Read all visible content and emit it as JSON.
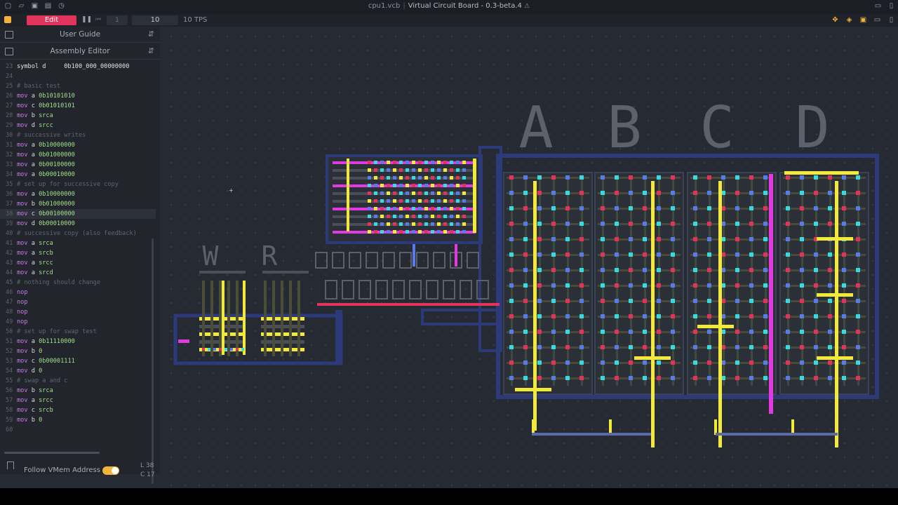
{
  "window": {
    "file_name": "cpu1.vcb",
    "app_name": "Virtual Circuit Board - 0.3-beta.4",
    "left_icons": [
      "new-file-icon",
      "open-folder-icon",
      "save-icon",
      "save-as-icon",
      "settings-clock-icon"
    ],
    "right_icons": [
      "book-icon",
      "panel-toggle-icon"
    ]
  },
  "toolbar": {
    "edit_label": "Edit",
    "pause_symbol": "❚❚",
    "step_symbol": "⏮",
    "step_value": "1",
    "speed_value": "10",
    "tps_label": "10 TPS",
    "right_icons": [
      "pin-icon",
      "layers-icon",
      "square-icon",
      "chat-icon",
      "sidebar-icon"
    ]
  },
  "sidebar": {
    "user_guide_title": "User Guide",
    "assembly_editor_title": "Assembly Editor",
    "code_lines": [
      {
        "n": "23",
        "parts": [
          [
            "ident",
            "symbol d     0b100_000_00000000"
          ]
        ]
      },
      {
        "n": "24",
        "parts": []
      },
      {
        "n": "25",
        "parts": [
          [
            "cmt",
            "# basic test"
          ]
        ]
      },
      {
        "n": "26",
        "parts": [
          [
            "kw",
            "mov "
          ],
          [
            "arg",
            "a "
          ],
          [
            "num",
            "0b10101010"
          ]
        ]
      },
      {
        "n": "27",
        "parts": [
          [
            "kw",
            "mov "
          ],
          [
            "arg",
            "c "
          ],
          [
            "num",
            "0b01010101"
          ]
        ]
      },
      {
        "n": "28",
        "parts": [
          [
            "kw",
            "mov "
          ],
          [
            "arg",
            "b "
          ],
          [
            "num",
            "srca"
          ]
        ]
      },
      {
        "n": "29",
        "parts": [
          [
            "kw",
            "mov "
          ],
          [
            "arg",
            "d "
          ],
          [
            "num",
            "srcc"
          ]
        ]
      },
      {
        "n": "30",
        "parts": [
          [
            "cmt",
            "# successive writes"
          ]
        ]
      },
      {
        "n": "31",
        "parts": [
          [
            "kw",
            "mov "
          ],
          [
            "arg",
            "a "
          ],
          [
            "num",
            "0b10000000"
          ]
        ]
      },
      {
        "n": "32",
        "parts": [
          [
            "kw",
            "mov "
          ],
          [
            "arg",
            "a "
          ],
          [
            "num",
            "0b01000000"
          ]
        ]
      },
      {
        "n": "33",
        "parts": [
          [
            "kw",
            "mov "
          ],
          [
            "arg",
            "a "
          ],
          [
            "num",
            "0b00100000"
          ]
        ]
      },
      {
        "n": "34",
        "parts": [
          [
            "kw",
            "mov "
          ],
          [
            "arg",
            "a "
          ],
          [
            "num",
            "0b00010000"
          ]
        ]
      },
      {
        "n": "35",
        "parts": [
          [
            "cmt",
            "# set up for successive copy"
          ]
        ]
      },
      {
        "n": "36",
        "parts": [
          [
            "kw",
            "mov "
          ],
          [
            "arg",
            "a "
          ],
          [
            "num",
            "0b10000000"
          ]
        ]
      },
      {
        "n": "37",
        "parts": [
          [
            "kw",
            "mov "
          ],
          [
            "arg",
            "b "
          ],
          [
            "num",
            "0b01000000"
          ]
        ]
      },
      {
        "n": "38",
        "parts": [
          [
            "kw",
            "mov "
          ],
          [
            "arg",
            "c "
          ],
          [
            "num",
            "0b00100000"
          ]
        ],
        "hl": true
      },
      {
        "n": "39",
        "parts": [
          [
            "kw",
            "mov "
          ],
          [
            "arg",
            "d "
          ],
          [
            "num",
            "0b00010000"
          ]
        ]
      },
      {
        "n": "40",
        "parts": [
          [
            "cmt",
            "# successive copy (also feedback)"
          ]
        ]
      },
      {
        "n": "41",
        "parts": [
          [
            "kw",
            "mov "
          ],
          [
            "arg",
            "a "
          ],
          [
            "num",
            "srca"
          ]
        ]
      },
      {
        "n": "42",
        "parts": [
          [
            "kw",
            "mov "
          ],
          [
            "arg",
            "a "
          ],
          [
            "num",
            "srcb"
          ]
        ]
      },
      {
        "n": "43",
        "parts": [
          [
            "kw",
            "mov "
          ],
          [
            "arg",
            "a "
          ],
          [
            "num",
            "srcc"
          ]
        ]
      },
      {
        "n": "44",
        "parts": [
          [
            "kw",
            "mov "
          ],
          [
            "arg",
            "a "
          ],
          [
            "num",
            "srcd"
          ]
        ]
      },
      {
        "n": "45",
        "parts": [
          [
            "cmt",
            "# nothing should change"
          ]
        ]
      },
      {
        "n": "46",
        "parts": [
          [
            "kw",
            "nop"
          ]
        ]
      },
      {
        "n": "47",
        "parts": [
          [
            "kw",
            "nop"
          ]
        ]
      },
      {
        "n": "48",
        "parts": [
          [
            "kw",
            "nop"
          ]
        ]
      },
      {
        "n": "49",
        "parts": [
          [
            "kw",
            "nop"
          ]
        ]
      },
      {
        "n": "50",
        "parts": [
          [
            "cmt",
            "# set up for swap test"
          ]
        ]
      },
      {
        "n": "51",
        "parts": [
          [
            "kw",
            "mov "
          ],
          [
            "arg",
            "a "
          ],
          [
            "num",
            "0b11110000"
          ]
        ]
      },
      {
        "n": "52",
        "parts": [
          [
            "kw",
            "mov "
          ],
          [
            "arg",
            "b "
          ],
          [
            "num",
            "0"
          ]
        ]
      },
      {
        "n": "53",
        "parts": [
          [
            "kw",
            "mov "
          ],
          [
            "arg",
            "c "
          ],
          [
            "num",
            "0b00001111"
          ]
        ]
      },
      {
        "n": "54",
        "parts": [
          [
            "kw",
            "mov "
          ],
          [
            "arg",
            "d "
          ],
          [
            "num",
            "0"
          ]
        ]
      },
      {
        "n": "55",
        "parts": [
          [
            "cmt",
            "# swap a and c"
          ]
        ]
      },
      {
        "n": "56",
        "parts": [
          [
            "kw",
            "mov "
          ],
          [
            "arg",
            "b "
          ],
          [
            "num",
            "srca"
          ]
        ]
      },
      {
        "n": "57",
        "parts": [
          [
            "kw",
            "mov "
          ],
          [
            "arg",
            "a "
          ],
          [
            "num",
            "srcc"
          ]
        ]
      },
      {
        "n": "58",
        "parts": [
          [
            "kw",
            "mov "
          ],
          [
            "arg",
            "c "
          ],
          [
            "num",
            "srcb"
          ]
        ]
      },
      {
        "n": "59",
        "parts": [
          [
            "kw",
            "mov "
          ],
          [
            "arg",
            "b "
          ],
          [
            "num",
            "0"
          ]
        ]
      },
      {
        "n": "60",
        "parts": []
      }
    ],
    "follow_label": "Follow VMem Address",
    "follow_enabled": true,
    "line_indicator": "L 38",
    "col_indicator": "C 17"
  },
  "board": {
    "register_labels": [
      "A",
      "B",
      "C",
      "D"
    ],
    "port_labels": [
      "W",
      "R"
    ],
    "colors": {
      "frame": "#2c3a7a",
      "trace": "#4a4a3a",
      "yellow": "#f2e93a",
      "magenta": "#e03ae0",
      "red": "#e0345c",
      "cyan": "#3ad8e0",
      "blue": "#5a7ae8"
    }
  }
}
